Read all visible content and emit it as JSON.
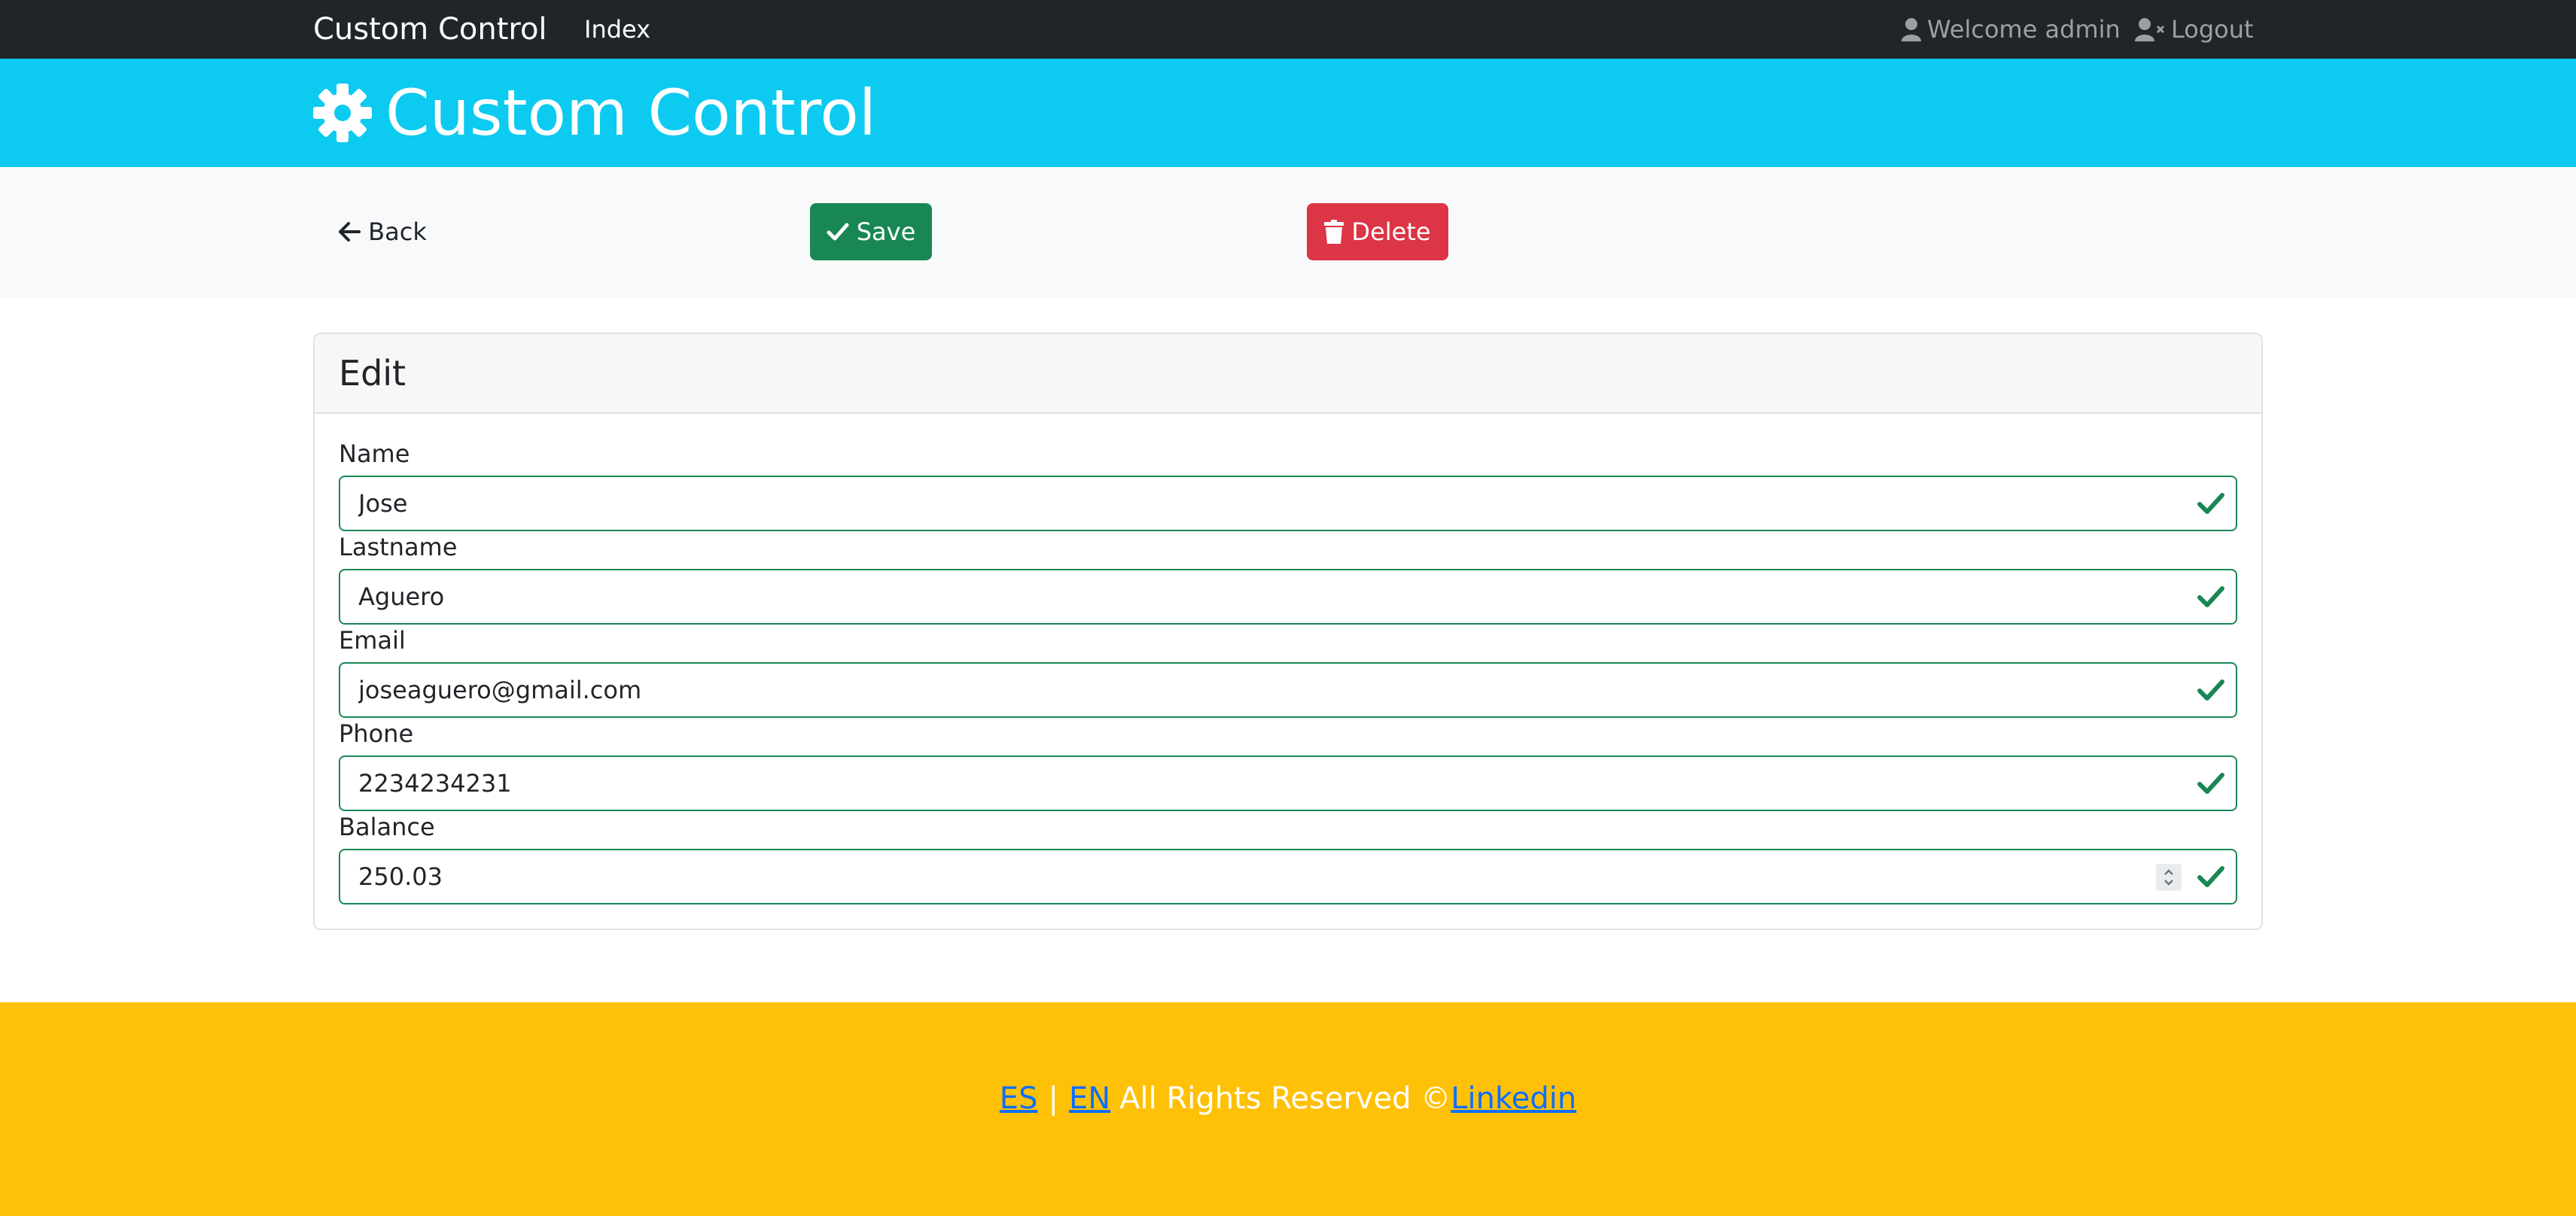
{
  "navbar": {
    "brand": "Custom Control",
    "index_link": "Index",
    "welcome": "Welcome admin",
    "logout": "Logout"
  },
  "hero": {
    "title": "Custom Control",
    "icon": "gear-icon"
  },
  "actions": {
    "back": "Back",
    "save": "Save",
    "delete": "Delete"
  },
  "card": {
    "title": "Edit",
    "fields": [
      {
        "label": "Name",
        "value": "Jose"
      },
      {
        "label": "Lastname",
        "value": "Aguero"
      },
      {
        "label": "Email",
        "value": "joseaguero@gmail.com"
      },
      {
        "label": "Phone",
        "value": "2234234231"
      },
      {
        "label": "Balance",
        "value": "250.03"
      }
    ]
  },
  "footer": {
    "es": "ES",
    "separator": "|",
    "en": "EN",
    "rights": "All Rights Reserved ©",
    "linkedin": "Linkedin"
  },
  "colors": {
    "navbar": "#212529",
    "hero": "#0dcaf0",
    "save": "#198754",
    "delete": "#dc3545",
    "footer": "#ffc107",
    "valid": "#198754"
  }
}
